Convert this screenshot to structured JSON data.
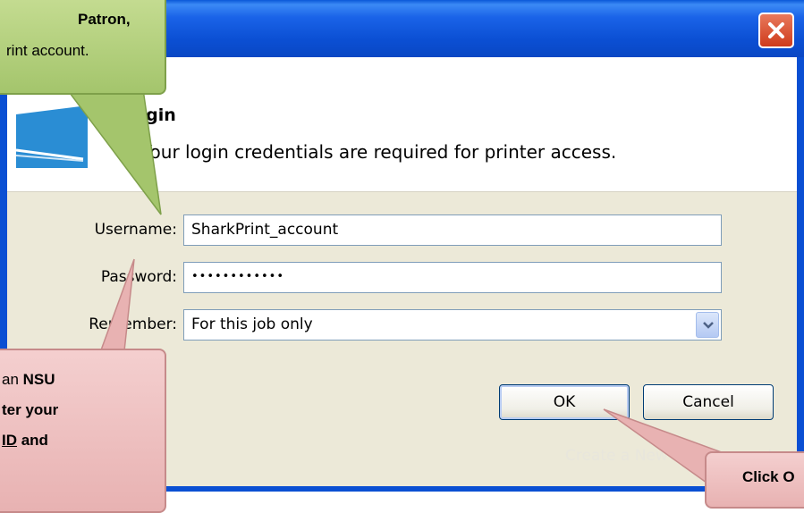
{
  "dialog": {
    "header_title": "Login",
    "header_subtitle": "Your login credentials are required for printer access.",
    "username_label": "Username:",
    "username_value": "SharkPrint_account",
    "password_label": "Password:",
    "password_value": "••••••••••••",
    "remember_label": "Remember:",
    "remember_value": "For this job only",
    "ok_label": "OK",
    "cancel_label": "Cancel",
    "create_account_link": "Create a New Print Account"
  },
  "callouts": {
    "top_line1": "Patron,",
    "top_line2": "rint account.",
    "bottom_line1_prefix": "an ",
    "bottom_line1_bold": "NSU",
    "bottom_line2": "ter your",
    "bottom_line3_underline": "ID",
    "bottom_line3_rest": " and",
    "click_label": "Click O"
  },
  "colors": {
    "titlebar": "#0a4fd3",
    "dialog_bg": "#ece9d8",
    "callout_green": "#a4c56c",
    "callout_pink": "#e8b2b2"
  }
}
